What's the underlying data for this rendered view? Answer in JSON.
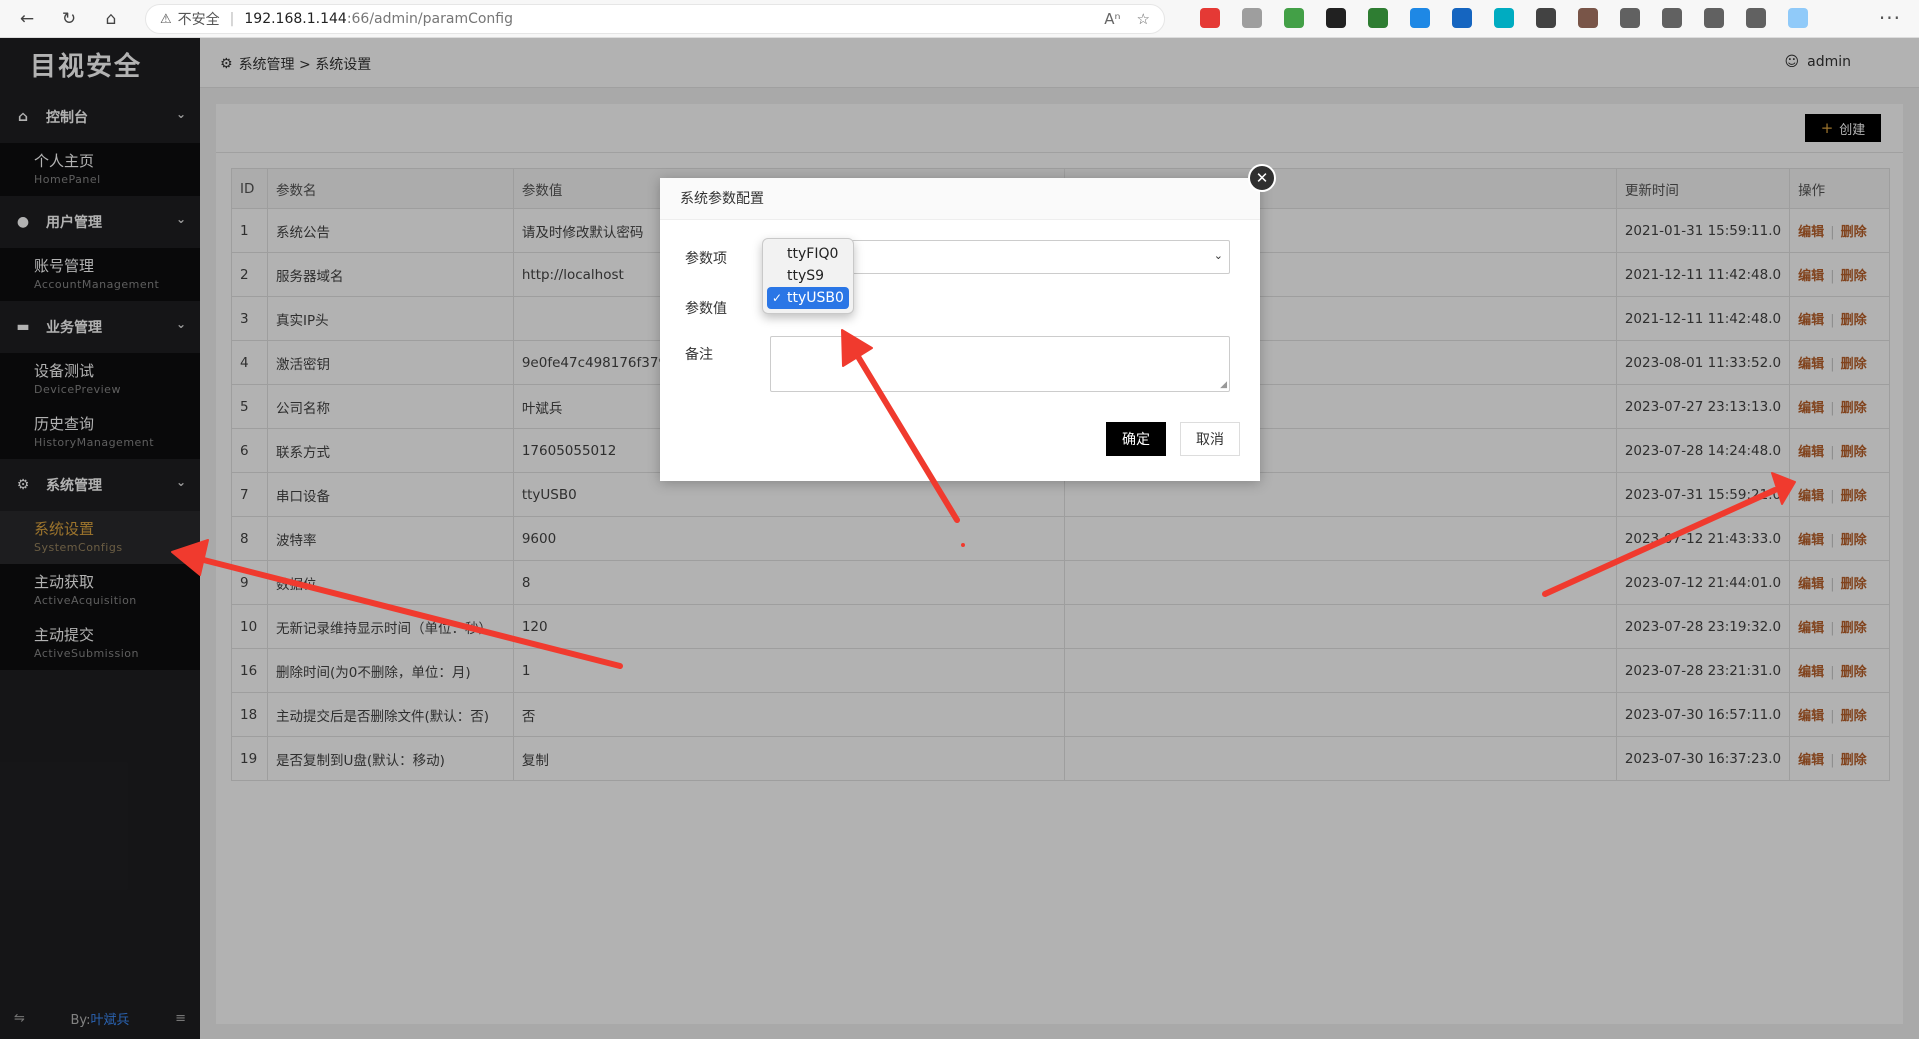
{
  "browser": {
    "insecure_label": "不安全",
    "url_host": "192.168.1.144",
    "url_path": ":66/admin/paramConfig",
    "ext_colors": [
      "#e53935",
      "#9e9e9e",
      "#43a047",
      "#212121",
      "#2e7d32",
      "#1e88e5",
      "#1565c0",
      "#00acc1",
      "#424242",
      "#795548",
      "#616161",
      "#616161",
      "#616161",
      "#616161",
      "#90caf9"
    ]
  },
  "sidebar": {
    "logo": "目视安全",
    "groups": [
      {
        "label": "控制台",
        "icon": "home-icon",
        "items": [
          {
            "cn": "个人主页",
            "en": "HomePanel"
          }
        ]
      },
      {
        "label": "用户管理",
        "icon": "user-icon",
        "items": [
          {
            "cn": "账号管理",
            "en": "AccountManagement"
          }
        ]
      },
      {
        "label": "业务管理",
        "icon": "card-icon",
        "items": [
          {
            "cn": "设备测试",
            "en": "DevicePreview"
          },
          {
            "cn": "历史查询",
            "en": "HistoryManagement"
          }
        ]
      },
      {
        "label": "系统管理",
        "icon": "gear-icon",
        "items": [
          {
            "cn": "系统设置",
            "en": "SystemConfigs"
          },
          {
            "cn": "主动获取",
            "en": "ActiveAcquisition"
          },
          {
            "cn": "主动提交",
            "en": "ActiveSubmission"
          }
        ]
      }
    ],
    "footer_prefix": "By:",
    "footer_author": "叶斌兵"
  },
  "header": {
    "breadcrumb": "系统管理 > 系统设置",
    "user": "admin"
  },
  "toolbar": {
    "create_label": "创建"
  },
  "table": {
    "columns": [
      "ID",
      "参数名",
      "参数值",
      "",
      "更新时间",
      "操作"
    ],
    "edit_label": "编辑",
    "delete_label": "删除",
    "rows": [
      {
        "id": "1",
        "name": "系统公告",
        "value": "请及时修改默认密码",
        "note": "",
        "time": "2021-01-31 15:59:11.0"
      },
      {
        "id": "2",
        "name": "服务器域名",
        "value": "http://localhost",
        "note": "",
        "time": "2021-12-11 11:42:48.0"
      },
      {
        "id": "3",
        "name": "真实IP头",
        "value": "",
        "note": "",
        "time": "2021-12-11 11:42:48.0"
      },
      {
        "id": "4",
        "name": "激活密钥",
        "value": "9e0fe47c498176f379b",
        "note": "",
        "time": "2023-08-01 11:33:52.0"
      },
      {
        "id": "5",
        "name": "公司名称",
        "value": "叶斌兵",
        "note": "",
        "time": "2023-07-27 23:13:13.0"
      },
      {
        "id": "6",
        "name": "联系方式",
        "value": "17605055012",
        "note": "",
        "time": "2023-07-28 14:24:48.0"
      },
      {
        "id": "7",
        "name": "串口设备",
        "value": "ttyUSB0",
        "note": "",
        "time": "2023-07-31 15:59:21.0"
      },
      {
        "id": "8",
        "name": "波特率",
        "value": "9600",
        "note": "",
        "time": "2023-07-12 21:43:33.0"
      },
      {
        "id": "9",
        "name": "数据位",
        "value": "8",
        "note": "",
        "time": "2023-07-12 21:44:01.0"
      },
      {
        "id": "10",
        "name": "无新记录维持显示时间（单位：秒）",
        "value": "120",
        "note": "",
        "time": "2023-07-28 23:19:32.0"
      },
      {
        "id": "16",
        "name": "删除时间(为0不删除，单位：月)",
        "value": "1",
        "note": "",
        "time": "2023-07-28 23:21:31.0"
      },
      {
        "id": "18",
        "name": "主动提交后是否删除文件(默认：否)",
        "value": "否",
        "note": "",
        "time": "2023-07-30 16:57:11.0"
      },
      {
        "id": "19",
        "name": "是否复制到U盘(默认：移动)",
        "value": "复制",
        "note": "",
        "time": "2023-07-30 16:37:23.0"
      }
    ]
  },
  "dialog": {
    "title": "系统参数配置",
    "param_item_label": "参数项",
    "param_value_label": "参数值",
    "remark_label": "备注",
    "ok_label": "确定",
    "cancel_label": "取消"
  },
  "dropdown": {
    "options": [
      "ttyFIQ0",
      "ttyS9",
      "ttyUSB0"
    ],
    "selected": "ttyUSB0"
  },
  "annotation": {
    "arrow_color": "#f03a2e"
  }
}
